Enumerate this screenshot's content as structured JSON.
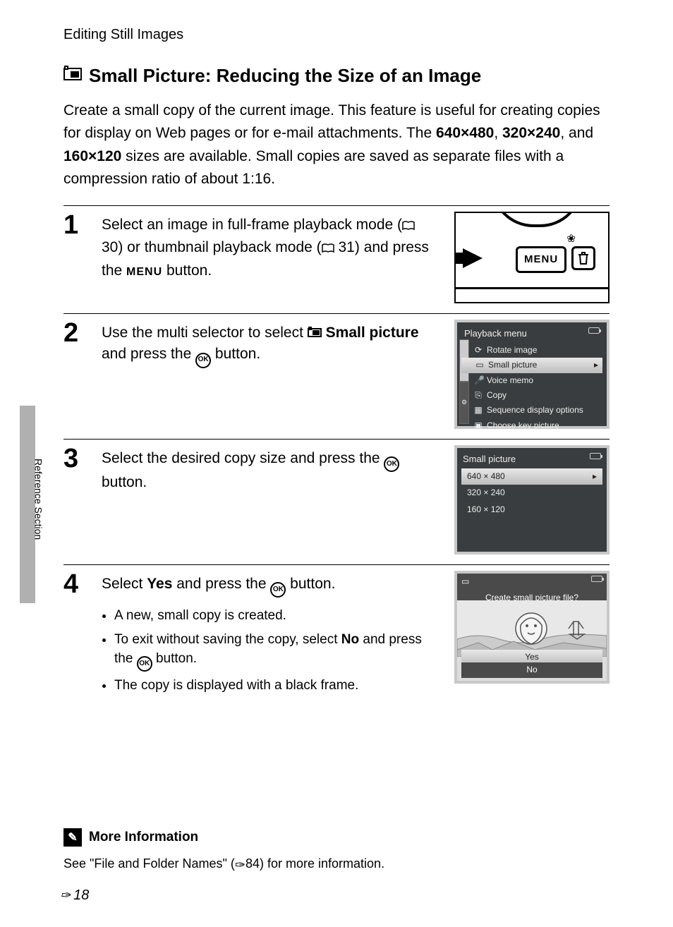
{
  "breadcrumb": "Editing Still Images",
  "title": "Small Picture: Reducing the Size of an Image",
  "intro_pre": "Create a small copy of the current image. This feature is useful for creating copies for display on Web pages or for e-mail attachments. The ",
  "intro_sizes": {
    "a": "640×480",
    "b": "320×240",
    "c": "160×120"
  },
  "intro_mid": ", and ",
  "intro_post": " sizes are available. Small copies are saved as separate files with a compression ratio of about 1:16.",
  "side_label": "Reference Section",
  "steps": {
    "s1": {
      "num": "1",
      "text_a": "Select an image in full-frame playback mode (",
      "ref1": " 30",
      "text_b": ") or thumbnail playback mode (",
      "ref2": " 31",
      "text_c": ") and press the ",
      "menu_word": "MENU",
      "text_d": " button."
    },
    "s2": {
      "num": "2",
      "text_a": "Use the multi selector to select ",
      "bold": "Small picture",
      "text_b": " and press the ",
      "ok": "OK",
      "text_c": " button."
    },
    "s3": {
      "num": "3",
      "text_a": "Select the desired copy size and press the ",
      "ok": "OK",
      "text_b": " button."
    },
    "s4": {
      "num": "4",
      "text_a": "Select ",
      "bold": "Yes",
      "text_b": " and press the ",
      "ok": "OK",
      "text_c": " button.",
      "b1": "A new, small copy is created.",
      "b2_a": "To exit without saving the copy, select ",
      "b2_bold": "No",
      "b2_b": " and press the ",
      "b2_c": " button.",
      "b3": "The copy is displayed with a black frame."
    }
  },
  "fig1": {
    "menu": "MENU"
  },
  "fig2": {
    "title": "Playback menu",
    "items": [
      "Rotate image",
      "Small picture",
      "Voice memo",
      "Copy",
      "Sequence display options",
      "Choose key picture"
    ]
  },
  "fig3": {
    "title": "Small picture",
    "opts": [
      "640 × 480",
      "320 × 240",
      "160 × 120"
    ]
  },
  "fig4": {
    "q": "Create small picture file?",
    "yes": "Yes",
    "no": "No"
  },
  "more": {
    "title": "More Information",
    "text_a": "See \"File and Folder Names\" (",
    "ref": "84",
    "text_b": ") for more information."
  },
  "page_num": "18"
}
